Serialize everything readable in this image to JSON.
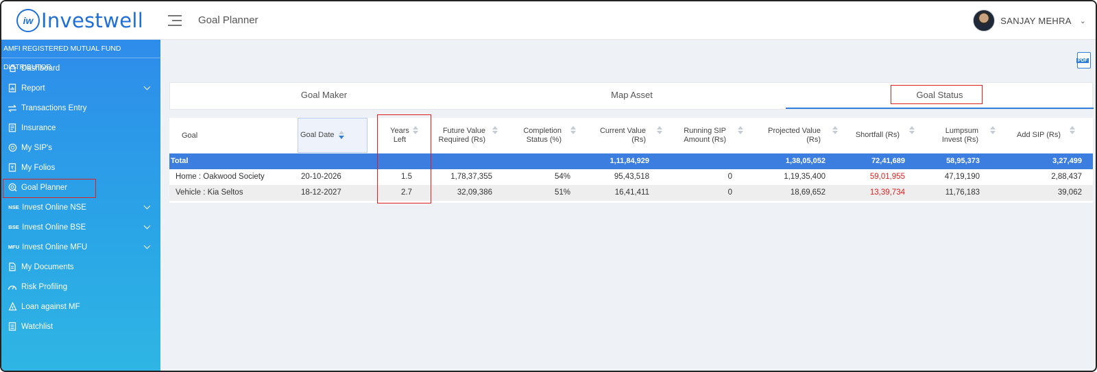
{
  "app": {
    "logo_mark": "iw",
    "logo_text": "Investwell",
    "page_title": "Goal Planner"
  },
  "user": {
    "name": "SANJAY MEHRA"
  },
  "sidebar": {
    "header": "AMFI REGISTERED MUTUAL FUND DISTRIBUTOR",
    "items": [
      {
        "label": "Dashboard",
        "icon": "home-icon"
      },
      {
        "label": "Report",
        "icon": "report-icon",
        "expandable": true
      },
      {
        "label": "Transactions Entry",
        "icon": "transfer-icon"
      },
      {
        "label": "Insurance",
        "icon": "insurance-icon"
      },
      {
        "label": "My SIP's",
        "icon": "sip-icon"
      },
      {
        "label": "My Folios",
        "icon": "folio-icon"
      },
      {
        "label": "Goal Planner",
        "icon": "goal-icon",
        "active": true
      },
      {
        "label": "Invest Online NSE",
        "icon_text": "NSE",
        "expandable": true
      },
      {
        "label": "Invest Online BSE",
        "icon_text": "BSE",
        "expandable": true
      },
      {
        "label": "Invest Online MFU",
        "icon_text": "MFU",
        "expandable": true
      },
      {
        "label": "My Documents",
        "icon": "document-icon"
      },
      {
        "label": "Risk Profiling",
        "icon": "gauge-icon"
      },
      {
        "label": "Loan against MF",
        "icon": "loan-icon"
      },
      {
        "label": "Watchlist",
        "icon": "watchlist-icon"
      }
    ]
  },
  "pdf": {
    "label": "PDF"
  },
  "tabs": [
    {
      "label": "Goal Maker"
    },
    {
      "label": "Map Asset"
    },
    {
      "label": "Goal Status",
      "active": true
    }
  ],
  "table": {
    "headers": {
      "goal": "Goal",
      "goal_date": "Goal Date",
      "years_left_1": "Years",
      "years_left_2": "Left",
      "fv_1": "Future Value",
      "fv_2": "Required (Rs)",
      "completion_1": "Completion",
      "completion_2": "Status (%)",
      "current_1": "Current Value",
      "current_2": "(Rs)",
      "sip_1": "Running SIP",
      "sip_2": "Amount (Rs)",
      "projected_1": "Projected Value",
      "projected_2": "(Rs)",
      "shortfall": "Shortfall (Rs)",
      "lumpsum_1": "Lumpsum",
      "lumpsum_2": "Invest (Rs)",
      "add_sip": "Add SIP (Rs)"
    },
    "total": {
      "label": "Total",
      "current_value": "1,11,84,929",
      "projected_value": "1,38,05,052",
      "shortfall": "72,41,689",
      "lumpsum": "58,95,373",
      "add_sip": "3,27,499"
    },
    "rows": [
      {
        "goal": "Home : Oakwood Society",
        "goal_date": "20-10-2026",
        "years_left": "1.5",
        "future_value": "1,78,37,355",
        "completion": "54%",
        "current_value": "95,43,518",
        "running_sip": "0",
        "projected_value": "1,19,35,400",
        "shortfall": "59,01,955",
        "lumpsum": "47,19,190",
        "add_sip": "2,88,437"
      },
      {
        "goal": "Vehicle : Kia Seltos",
        "goal_date": "18-12-2027",
        "years_left": "2.7",
        "future_value": "32,09,386",
        "completion": "51%",
        "current_value": "16,41,411",
        "running_sip": "0",
        "projected_value": "18,69,652",
        "shortfall": "13,39,734",
        "lumpsum": "11,76,183",
        "add_sip": "39,062"
      }
    ]
  },
  "colors": {
    "brand": "#1e6fd9",
    "sidebar": "#2e8cea",
    "total_row": "#3c7ee0",
    "highlight": "#e02020",
    "shortfall": "#e02020"
  }
}
